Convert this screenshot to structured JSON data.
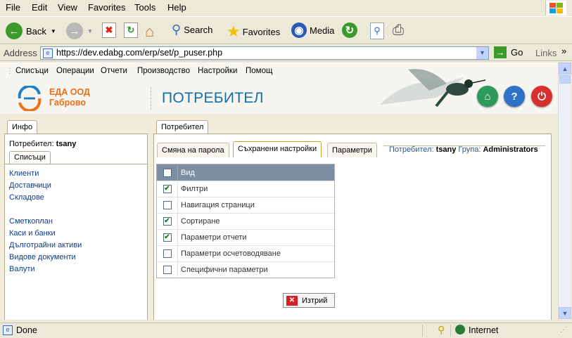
{
  "browser": {
    "menu": [
      "File",
      "Edit",
      "View",
      "Favorites",
      "Tools",
      "Help"
    ],
    "toolbar": {
      "back": "Back",
      "search": "Search",
      "favorites": "Favorites",
      "media": "Media"
    },
    "address_label": "Address",
    "url": "https://dev.edabg.com/erp/set/p_puser.php",
    "go": "Go",
    "links": "Links",
    "status": "Done",
    "zone": "Internet"
  },
  "app": {
    "menu": [
      "Списъци",
      "Операции",
      "Отчети",
      "Производство",
      "Настройки",
      "Помощ"
    ],
    "company_name": "ЕДА ООД",
    "company_city": "Габрово",
    "page_title": "ПОТРЕБИТЕЛ"
  },
  "left": {
    "tab": "Инфо",
    "user_label": "Потребител:",
    "user_value": "tsany",
    "sub_tab": "Списъци",
    "links_group1": [
      "Клиенти",
      "Доставчици",
      "Складове"
    ],
    "links_group2": [
      "Сметкоплан",
      "Каси и банки",
      "Дълготрайни активи",
      "Видове документи",
      "Валути"
    ]
  },
  "right": {
    "tab": "Потребител",
    "subtabs": [
      "Смяна на парола",
      "Съхранени настройки",
      "Параметри"
    ],
    "active_subtab": 1,
    "user_label": "Потребител:",
    "user_value": "tsany",
    "group_label": "Група:",
    "group_value": "Administrators",
    "grid": {
      "header": "Вид",
      "rows": [
        {
          "label": "Филтри",
          "checked": true
        },
        {
          "label": "Навигация страници",
          "checked": false
        },
        {
          "label": "Сортиране",
          "checked": true
        },
        {
          "label": "Параметри отчети",
          "checked": true
        },
        {
          "label": "Параметри осчетоводяване",
          "checked": false
        },
        {
          "label": "Специфични параметри",
          "checked": false
        }
      ]
    },
    "delete_button": "Изтрий"
  },
  "icons": [
    "back-icon",
    "forward-icon",
    "stop-icon",
    "refresh-icon",
    "home-icon",
    "search-icon",
    "favorites-star-icon",
    "media-icon",
    "history-icon",
    "mail-icon",
    "print-icon",
    "page-icon",
    "go-arrow-icon",
    "lock-icon",
    "globe-icon",
    "app-home-icon",
    "help-icon",
    "power-icon",
    "delete-x-icon",
    "hummingbird-icon"
  ]
}
